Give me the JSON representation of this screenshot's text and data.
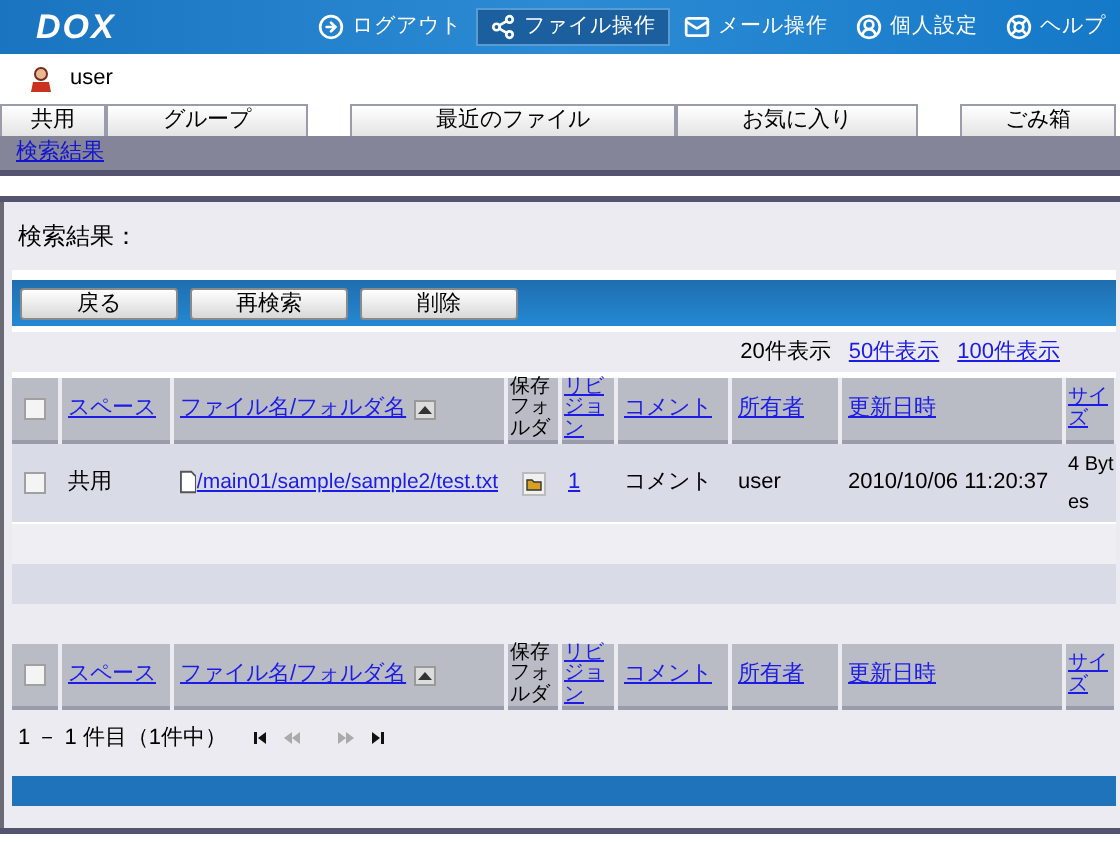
{
  "header": {
    "logo": "DOX",
    "nav": [
      {
        "kind": "logout",
        "label": "ログアウト",
        "selected": false
      },
      {
        "kind": "files",
        "label": "ファイル操作",
        "selected": true
      },
      {
        "kind": "mail",
        "label": "メール操作",
        "selected": false
      },
      {
        "kind": "user",
        "label": "個人設定",
        "selected": false
      },
      {
        "kind": "help",
        "label": "ヘルプ",
        "selected": false
      }
    ]
  },
  "user": {
    "name": "user"
  },
  "tabs": [
    {
      "label": "共用"
    },
    {
      "label": "グループ"
    },
    {
      "label": "最近のファイル"
    },
    {
      "label": "お気に入り"
    },
    {
      "label": "ごみ箱"
    }
  ],
  "breadcrumb": "検索結果",
  "title": "検索結果：",
  "buttons": [
    "戻る",
    "再検索",
    "削除"
  ],
  "page_size": {
    "current": "20件表示",
    "options": [
      "50件表示",
      "100件表示"
    ]
  },
  "table": {
    "columns": [
      {
        "label": "スペース",
        "link": true,
        "sorted": false
      },
      {
        "label": "ファイル名/フォルダ名",
        "link": true,
        "sorted": true
      },
      {
        "label": "保存フォルダ",
        "link": false,
        "sorted": false
      },
      {
        "label": "リビジョン",
        "link": true,
        "sorted": false
      },
      {
        "label": "コメント",
        "link": true,
        "sorted": false
      },
      {
        "label": "所有者",
        "link": true,
        "sorted": false
      },
      {
        "label": "更新日時",
        "link": true,
        "sorted": false
      },
      {
        "label": "サイズ",
        "link": true,
        "sorted": false
      }
    ],
    "header_checked": false,
    "rows": [
      {
        "checked": false,
        "space": "共用",
        "file": "/main01/sample/sample2/test.txt",
        "revision": "1",
        "comment": "コメント",
        "owner": "user",
        "updated": "2010/10/06 11:20:37",
        "size": "4 Bytes"
      }
    ],
    "footer_columns": [
      {
        "label": "スペース",
        "link": true,
        "sorted": false
      },
      {
        "label": "ファイル名/フォルダ名",
        "link": true,
        "sorted": true
      },
      {
        "label": "保存フォルダ",
        "link": false,
        "sorted": false
      },
      {
        "label": "リビジョン",
        "link": true,
        "sorted": false
      },
      {
        "label": "コメント",
        "link": true,
        "sorted": false
      },
      {
        "label": "所有者",
        "link": true,
        "sorted": false
      },
      {
        "label": "更新日時",
        "link": true,
        "sorted": false
      },
      {
        "label": "サイズ",
        "link": true,
        "sorted": false
      }
    ],
    "footer_checked": false
  },
  "pager": {
    "text": "1 － 1 件目（1件中）",
    "controls": [
      {
        "kind": "first",
        "disabled": false
      },
      {
        "kind": "prev",
        "disabled": true
      },
      {
        "kind": "next",
        "disabled": true
      },
      {
        "kind": "last",
        "disabled": false
      }
    ]
  }
}
